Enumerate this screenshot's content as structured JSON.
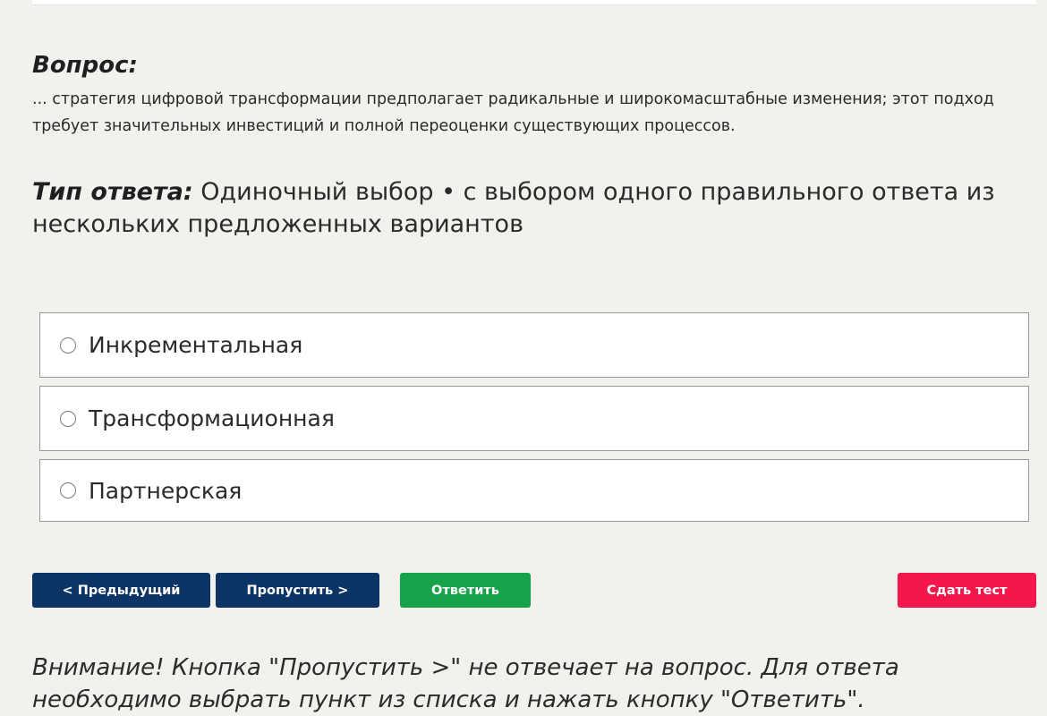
{
  "question": {
    "heading": "Вопрос:",
    "text": "... стратегия цифровой трансформации предполагает радикальные и широкомасштабные изменения; этот подход требует значительных инвестиций и полной переоценки существующих процессов."
  },
  "answer_type": {
    "label": "Тип ответа:",
    "value": "Одиночный выбор • с выбором одного правильного ответа из нескольких предложенных вариантов"
  },
  "options": [
    {
      "label": "Инкрементальная",
      "selected": false
    },
    {
      "label": "Трансформационная",
      "selected": false
    },
    {
      "label": "Партнерская",
      "selected": false
    }
  ],
  "buttons": {
    "prev": "< Предыдущий",
    "skip": "Пропустить >",
    "answer": "Ответить",
    "submit": "Сдать тест"
  },
  "colors": {
    "primary": "#0c3566",
    "answer": "#17a24a",
    "submit": "#f4174b",
    "background": "#f2f1ee"
  },
  "warning": "Внимание! Кнопка \"Пропустить >\" не отвечает на вопрос. Для ответа необходимо выбрать пункт из списка и нажать кнопку \"Ответить\"."
}
